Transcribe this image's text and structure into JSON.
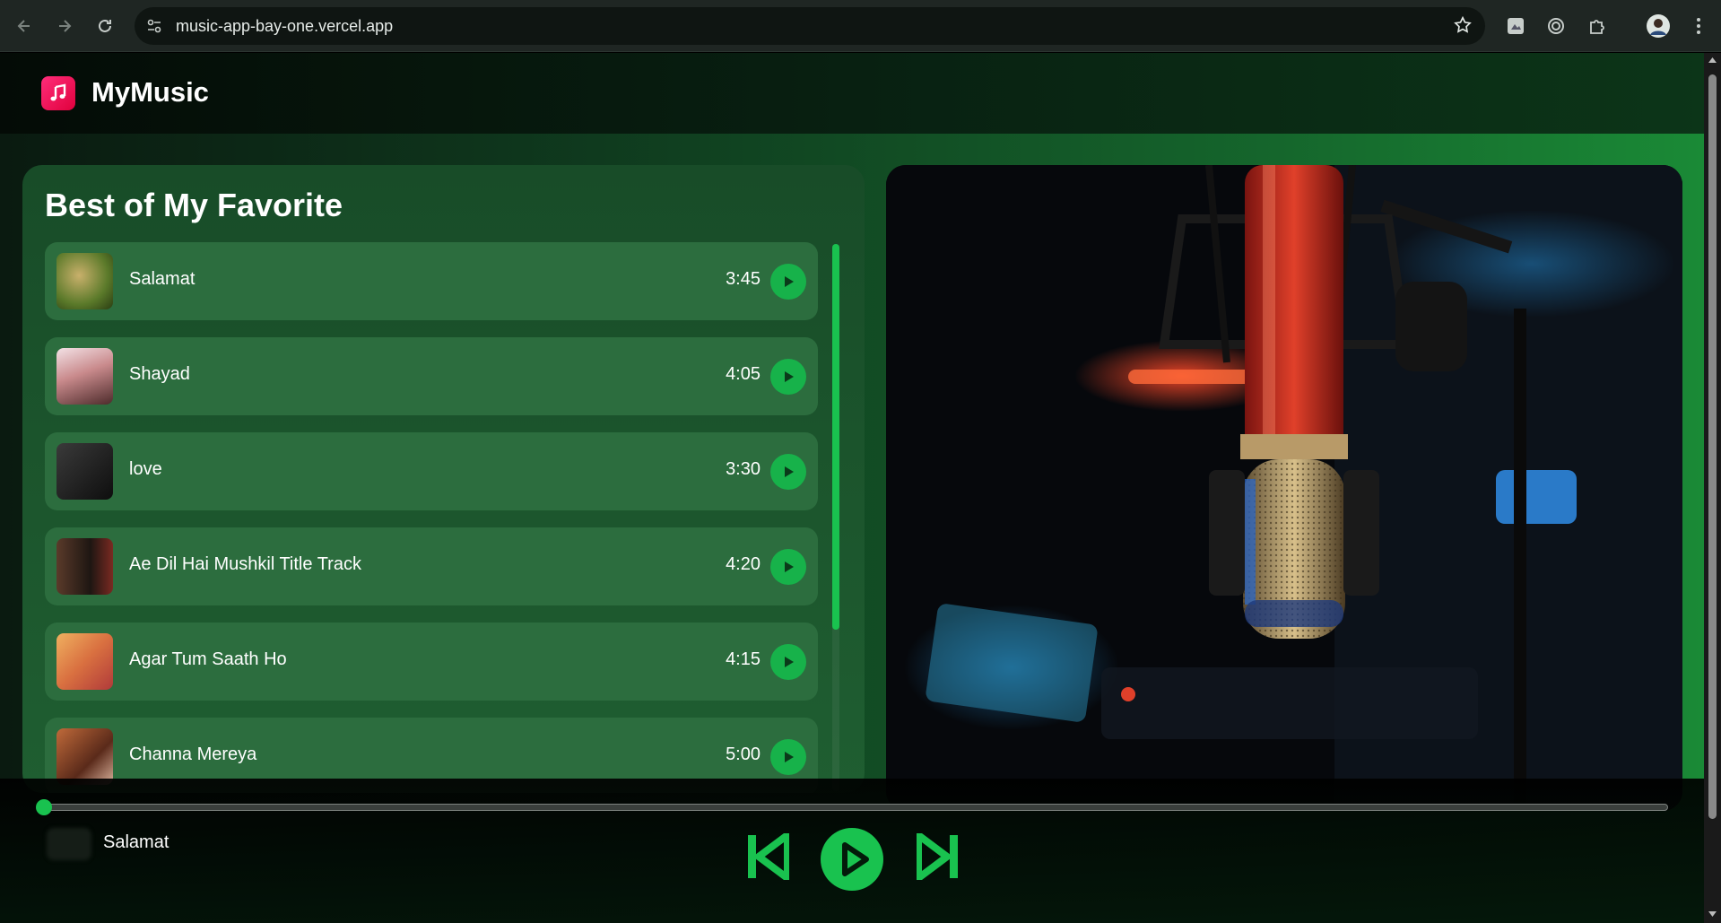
{
  "browser": {
    "url": "music-app-bay-one.vercel.app",
    "icons": [
      "back-icon",
      "forward-icon",
      "reload-icon",
      "site-info-icon",
      "bookmark-star-icon",
      "extension-icon",
      "lens-icon",
      "puzzle-icon",
      "profile-avatar",
      "menu-kebab-icon"
    ]
  },
  "app": {
    "brand": "MyMusic",
    "logo_icon": "music-note-icon",
    "accent": "#19c24f",
    "logo_color": "#ff2d7a"
  },
  "playlist": {
    "title": "Best of My Favorite",
    "songs": [
      {
        "title": "Salamat",
        "duration": "3:45"
      },
      {
        "title": "Shayad",
        "duration": "4:05"
      },
      {
        "title": "love",
        "duration": "3:30"
      },
      {
        "title": "Ae Dil Hai Mushkil Title Track",
        "duration": "4:20"
      },
      {
        "title": "Agar Tum Saath Ho",
        "duration": "4:15"
      },
      {
        "title": "Channa Mereya",
        "duration": "5:00"
      }
    ]
  },
  "player": {
    "now_playing": "Salamat",
    "progress_fraction": 0.0,
    "controls": [
      "previous-icon",
      "play-icon",
      "next-icon"
    ]
  }
}
